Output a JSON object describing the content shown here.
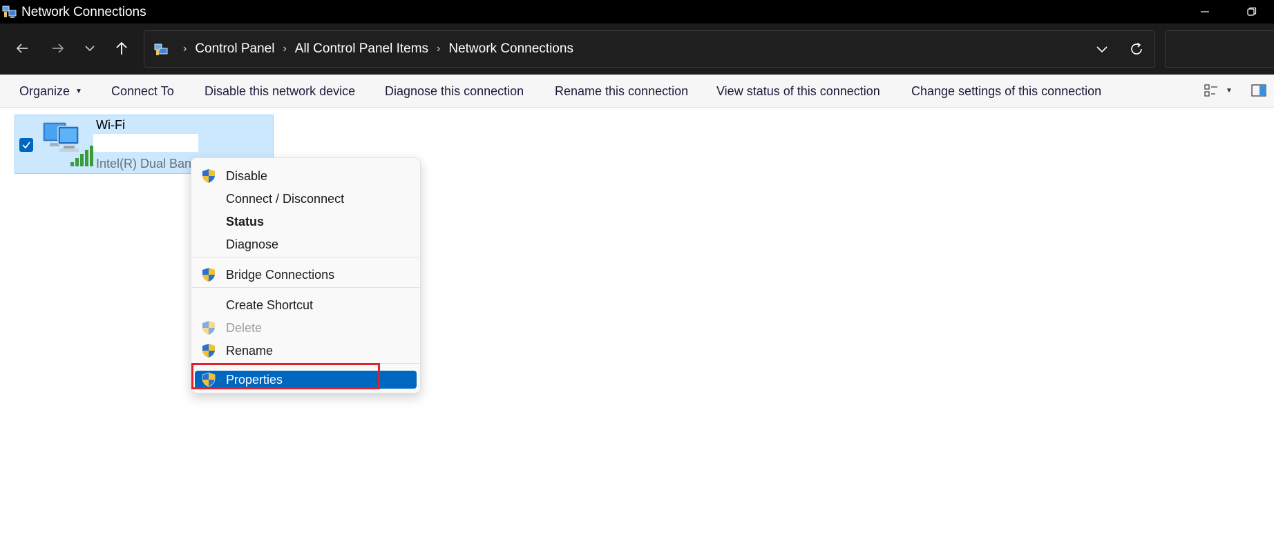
{
  "window": {
    "title": "Network Connections"
  },
  "address_bar": {
    "crumbs": [
      "Control Panel",
      "All Control Panel Items",
      "Network Connections"
    ]
  },
  "command_bar": {
    "organize": "Organize",
    "connect_to": "Connect To",
    "disable_device": "Disable this network device",
    "diagnose": "Diagnose this connection",
    "rename": "Rename this connection",
    "view_status": "View status of this connection",
    "change_settings": "Change settings of this connection"
  },
  "connection": {
    "name": "Wi-Fi",
    "device": "Intel(R) Dual Band"
  },
  "context_menu": {
    "items": [
      {
        "label": "Disable",
        "shield": true
      },
      {
        "label": "Connect / Disconnect",
        "shield": false
      },
      {
        "label": "Status",
        "shield": false,
        "bold": true
      },
      {
        "label": "Diagnose",
        "shield": false
      },
      {
        "label": "Bridge Connections",
        "shield": true
      },
      {
        "label": "Create Shortcut",
        "shield": false
      },
      {
        "label": "Delete",
        "shield": true,
        "disabled": true
      },
      {
        "label": "Rename",
        "shield": true
      },
      {
        "label": "Properties",
        "shield": true,
        "active": true
      }
    ]
  },
  "colors": {
    "accent": "#0067c0",
    "selection": "#cce8ff",
    "highlight_border": "#e0202a"
  }
}
